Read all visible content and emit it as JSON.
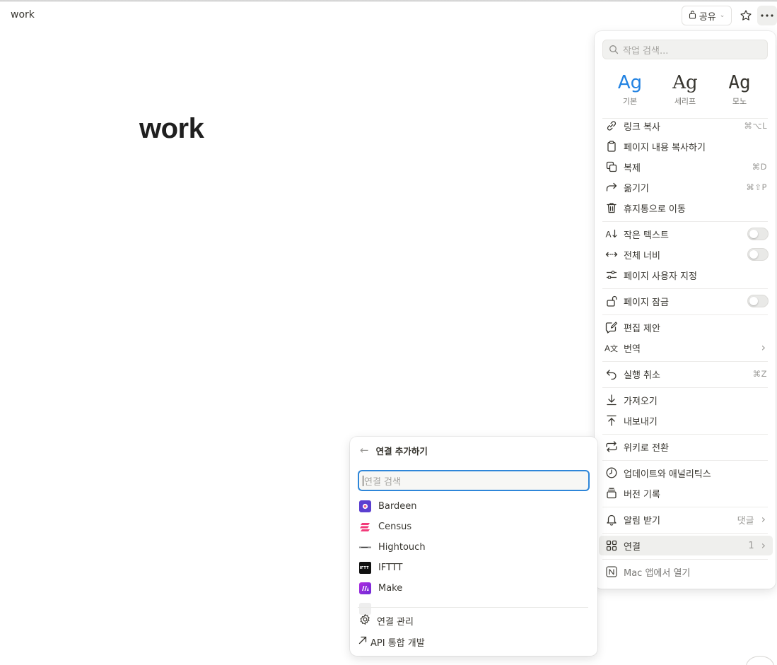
{
  "topbar": {
    "breadcrumb": "work",
    "share_label": "공유"
  },
  "page": {
    "title": "work"
  },
  "menu": {
    "search_placeholder": "작업 검색...",
    "fonts": [
      {
        "sample": "Ag",
        "label": "기본",
        "selected": true
      },
      {
        "sample": "Ag",
        "label": "세리프",
        "selected": false
      },
      {
        "sample": "Ag",
        "label": "모노",
        "selected": false
      }
    ],
    "items": {
      "copy_link": {
        "label": "링크 복사",
        "shortcut": "⌘⌥L"
      },
      "copy_content": {
        "label": "페이지 내용 복사하기"
      },
      "duplicate": {
        "label": "복제",
        "shortcut": "⌘D"
      },
      "move": {
        "label": "옮기기",
        "shortcut": "⌘⇧P"
      },
      "trash": {
        "label": "휴지통으로 이동"
      },
      "small_text": {
        "label": "작은 텍스트",
        "on": false
      },
      "full_width": {
        "label": "전체 너비",
        "on": false
      },
      "customize": {
        "label": "페이지 사용자 지정"
      },
      "lock": {
        "label": "페이지 잠금",
        "on": false
      },
      "suggest": {
        "label": "편집 제안"
      },
      "translate": {
        "label": "번역"
      },
      "undo": {
        "label": "실행 취소",
        "shortcut": "⌘Z"
      },
      "import": {
        "label": "가져오기"
      },
      "export": {
        "label": "내보내기"
      },
      "wiki": {
        "label": "위키로 전환"
      },
      "analytics": {
        "label": "업데이트와 애널리틱스"
      },
      "history": {
        "label": "버전 기록"
      },
      "notify": {
        "label": "알림 받기",
        "value": "댓글"
      },
      "connections": {
        "label": "연결",
        "value": "1"
      },
      "open_mac": {
        "label": "Mac 앱에서 열기"
      }
    }
  },
  "connections_popup": {
    "title": "연결 추가하기",
    "search_placeholder": "연결 검색",
    "items": [
      {
        "name": "Bardeen",
        "logo": "bardeen-logo",
        "color": "#5b3fd0"
      },
      {
        "name": "Census",
        "logo": "census-logo",
        "color": "#f23b7a"
      },
      {
        "name": "Hightouch",
        "logo": "hightouch-logo",
        "color": "#333333"
      },
      {
        "name": "IFTTT",
        "logo": "ifttt-logo",
        "color": "#111111"
      },
      {
        "name": "Make",
        "logo": "make-logo",
        "color": "#7b2bd6"
      }
    ],
    "footer": {
      "manage": "연결 관리",
      "api": "API 통합 개발"
    }
  }
}
